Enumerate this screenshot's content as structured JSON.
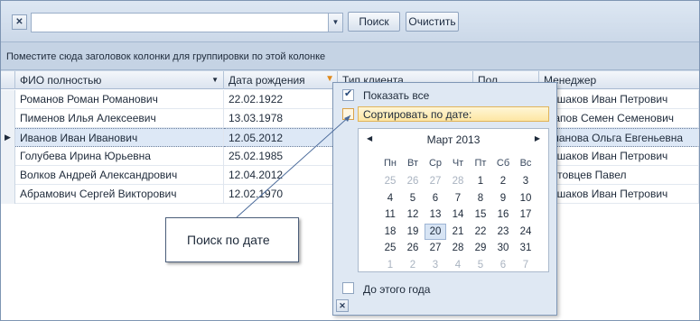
{
  "toolbar": {
    "clear_icon": "close-icon",
    "combo_value": "",
    "search_label": "Поиск",
    "clear_label": "Очистить"
  },
  "group_panel": {
    "text": "Поместите сюда заголовок колонки для группировки по этой колонке"
  },
  "grid": {
    "columns": [
      "ФИО полностью",
      "Дата рождения",
      "Тип клиента",
      "Пол",
      "Менеджер"
    ],
    "rows": [
      [
        "Романов Роман Романович",
        "22.02.1922",
        "",
        "",
        "Сушаков Иван Петрович"
      ],
      [
        "Пименов Илья Алексеевич",
        "13.03.1978",
        "",
        "",
        "Щапов Семен Семенович"
      ],
      [
        "Иванов Иван Иванович",
        "12.05.2012",
        "",
        "",
        "Иманова Ольга Евгеньевна"
      ],
      [
        "Голубева Ирина Юрьевна",
        "25.02.1985",
        "",
        "",
        "Сушаков Иван Петрович"
      ],
      [
        "Волков Андрей Александрович",
        "12.04.2012",
        "",
        "",
        "Пятовцев Павел"
      ],
      [
        "Абрамович Сергей Викторович",
        "12.02.1970",
        "",
        "",
        "Сушаков Иван Петрович"
      ]
    ],
    "selected_row": 2
  },
  "popup": {
    "show_all": "Показать все",
    "sort_by_date": "Сортировать по дате:",
    "to_year": "До этого года",
    "calendar": {
      "month": "Март 2013",
      "day_names": [
        "Пн",
        "Вт",
        "Ср",
        "Чт",
        "Пт",
        "Сб",
        "Вс"
      ],
      "weeks": [
        [
          "25",
          "26",
          "27",
          "28",
          "1",
          "2",
          "3"
        ],
        [
          "4",
          "5",
          "6",
          "7",
          "8",
          "9",
          "10"
        ],
        [
          "11",
          "12",
          "13",
          "14",
          "15",
          "16",
          "17"
        ],
        [
          "18",
          "19",
          "20",
          "21",
          "22",
          "23",
          "24"
        ],
        [
          "25",
          "26",
          "27",
          "28",
          "29",
          "30",
          "31"
        ],
        [
          "1",
          "2",
          "3",
          "4",
          "5",
          "6",
          "7"
        ]
      ]
    }
  },
  "callout": {
    "text": "Поиск по дате"
  }
}
